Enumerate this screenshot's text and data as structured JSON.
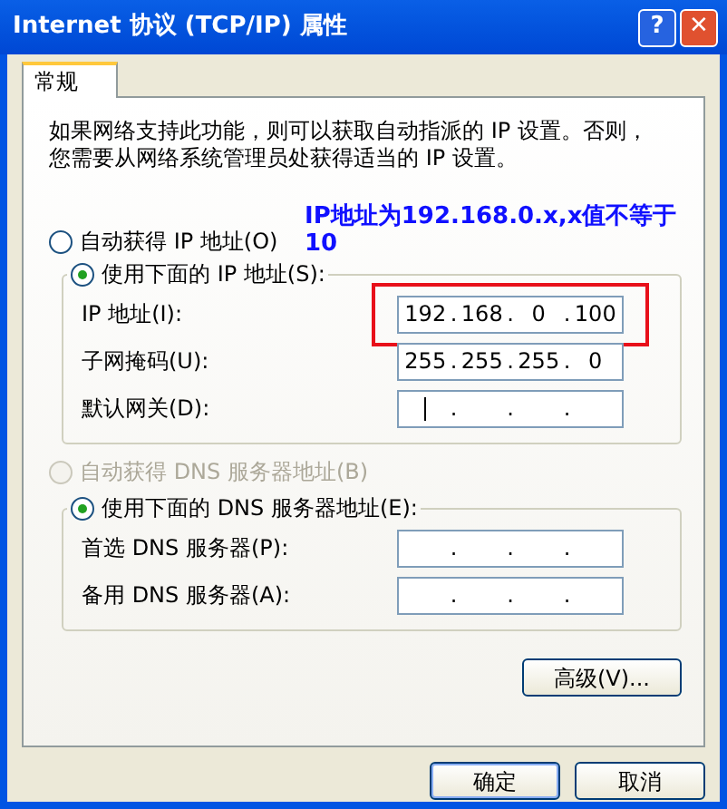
{
  "window": {
    "title": "Internet 协议 (TCP/IP) 属性"
  },
  "title_buttons": [
    {
      "kind": "help",
      "label": "?"
    },
    {
      "kind": "close",
      "label": "✕"
    }
  ],
  "tabs": [
    {
      "label": "常规",
      "selected": true
    }
  ],
  "description": "如果网络支持此功能，则可以获取自动指派的 IP 设置。否则，您需要从网络系统管理员处获得适当的 IP 设置。",
  "annotation": "IP地址为192.168.0.x,x值不等于10",
  "ip_auto": {
    "label": "自动获得 IP 地址(O)",
    "selected": false,
    "disabled": false
  },
  "ip_group": {
    "radio": {
      "label": "使用下面的 IP 地址(S):",
      "selected": true,
      "disabled": false
    },
    "fields": [
      {
        "label": "IP 地址(I):",
        "segments": [
          "192",
          "168",
          "0",
          "100"
        ],
        "separator": ".",
        "highlighted": true,
        "focused": false
      },
      {
        "label": "子网掩码(U):",
        "segments": [
          "255",
          "255",
          "255",
          "0"
        ],
        "separator": ".",
        "highlighted": false,
        "focused": false
      },
      {
        "label": "默认网关(D):",
        "separator": ".",
        "highlighted": false,
        "focused": true
      }
    ]
  },
  "dns_auto": {
    "label": "自动获得 DNS 服务器地址(B)",
    "selected": false,
    "disabled": true
  },
  "dns_group": {
    "radio": {
      "label": "使用下面的 DNS 服务器地址(E):",
      "selected": true,
      "disabled": false
    },
    "fields": [
      {
        "label": "首选 DNS 服务器(P):",
        "separator": ".",
        "highlighted": false,
        "focused": false
      },
      {
        "label": "备用 DNS 服务器(A):",
        "separator": ".",
        "highlighted": false,
        "focused": false
      }
    ]
  },
  "advanced_button": "高级(V)...",
  "buttons": [
    "确定",
    "取消"
  ]
}
